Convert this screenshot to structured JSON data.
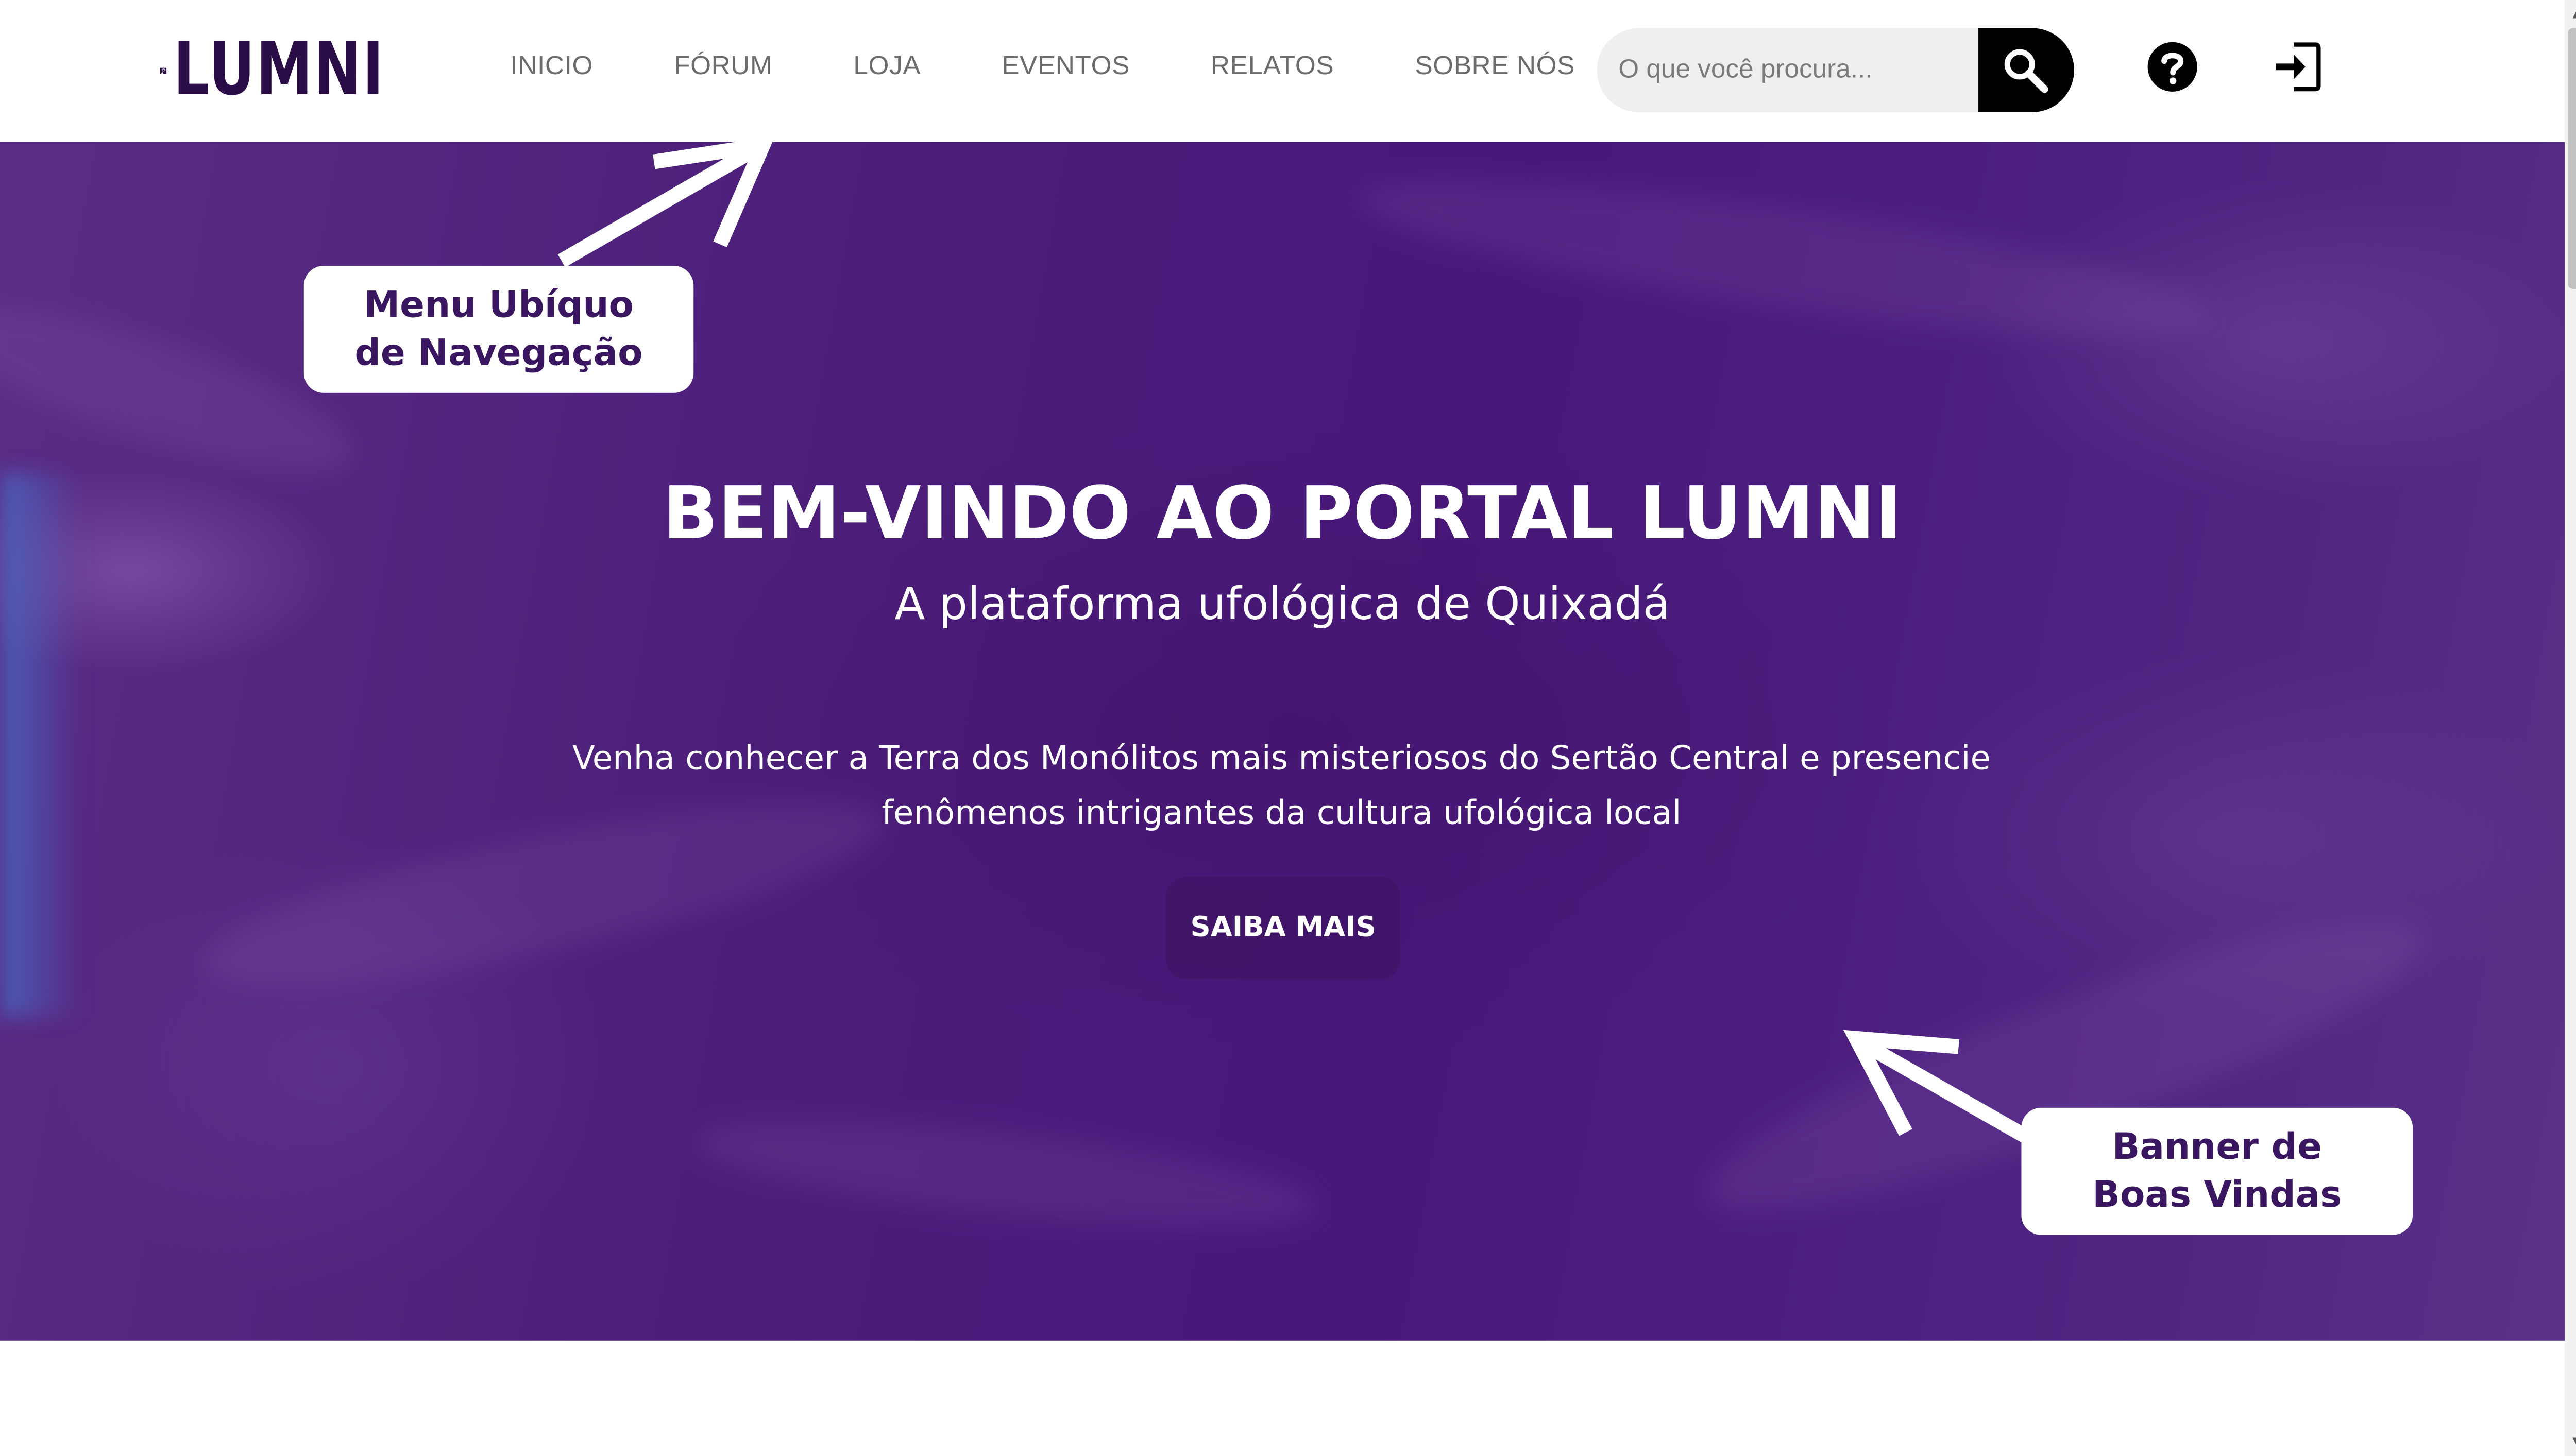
{
  "header": {
    "logo_text": "LUMNI",
    "nav": [
      "INICIO",
      "FÓRUM",
      "LOJA",
      "EVENTOS",
      "RELATOS",
      "SOBRE NÓS"
    ],
    "search": {
      "placeholder": "O que você procura...",
      "value": ""
    },
    "icons": {
      "search": "search-icon",
      "help": "question-circle-icon",
      "login": "sign-in-icon"
    }
  },
  "banner": {
    "title": "BEM-VINDO AO PORTAL LUMNI",
    "subtitle": "A plataforma ufológica de Quixadá",
    "description": "Venha conhecer a Terra dos Monólitos mais misteriosos do Sertão Central e presencie fenômenos intrigantes da cultura ufológica local",
    "cta_label": "SAIBA MAIS"
  },
  "annotations": {
    "menu_line1": "Menu Ubíquo",
    "menu_line2": "de Navegação",
    "banner_line1": "Banner de",
    "banner_line2": "Boas Vindas"
  },
  "colors": {
    "brand": "#2a0c47",
    "banner_purple": "#4c1f7a",
    "annotation_text": "#3a1660"
  }
}
